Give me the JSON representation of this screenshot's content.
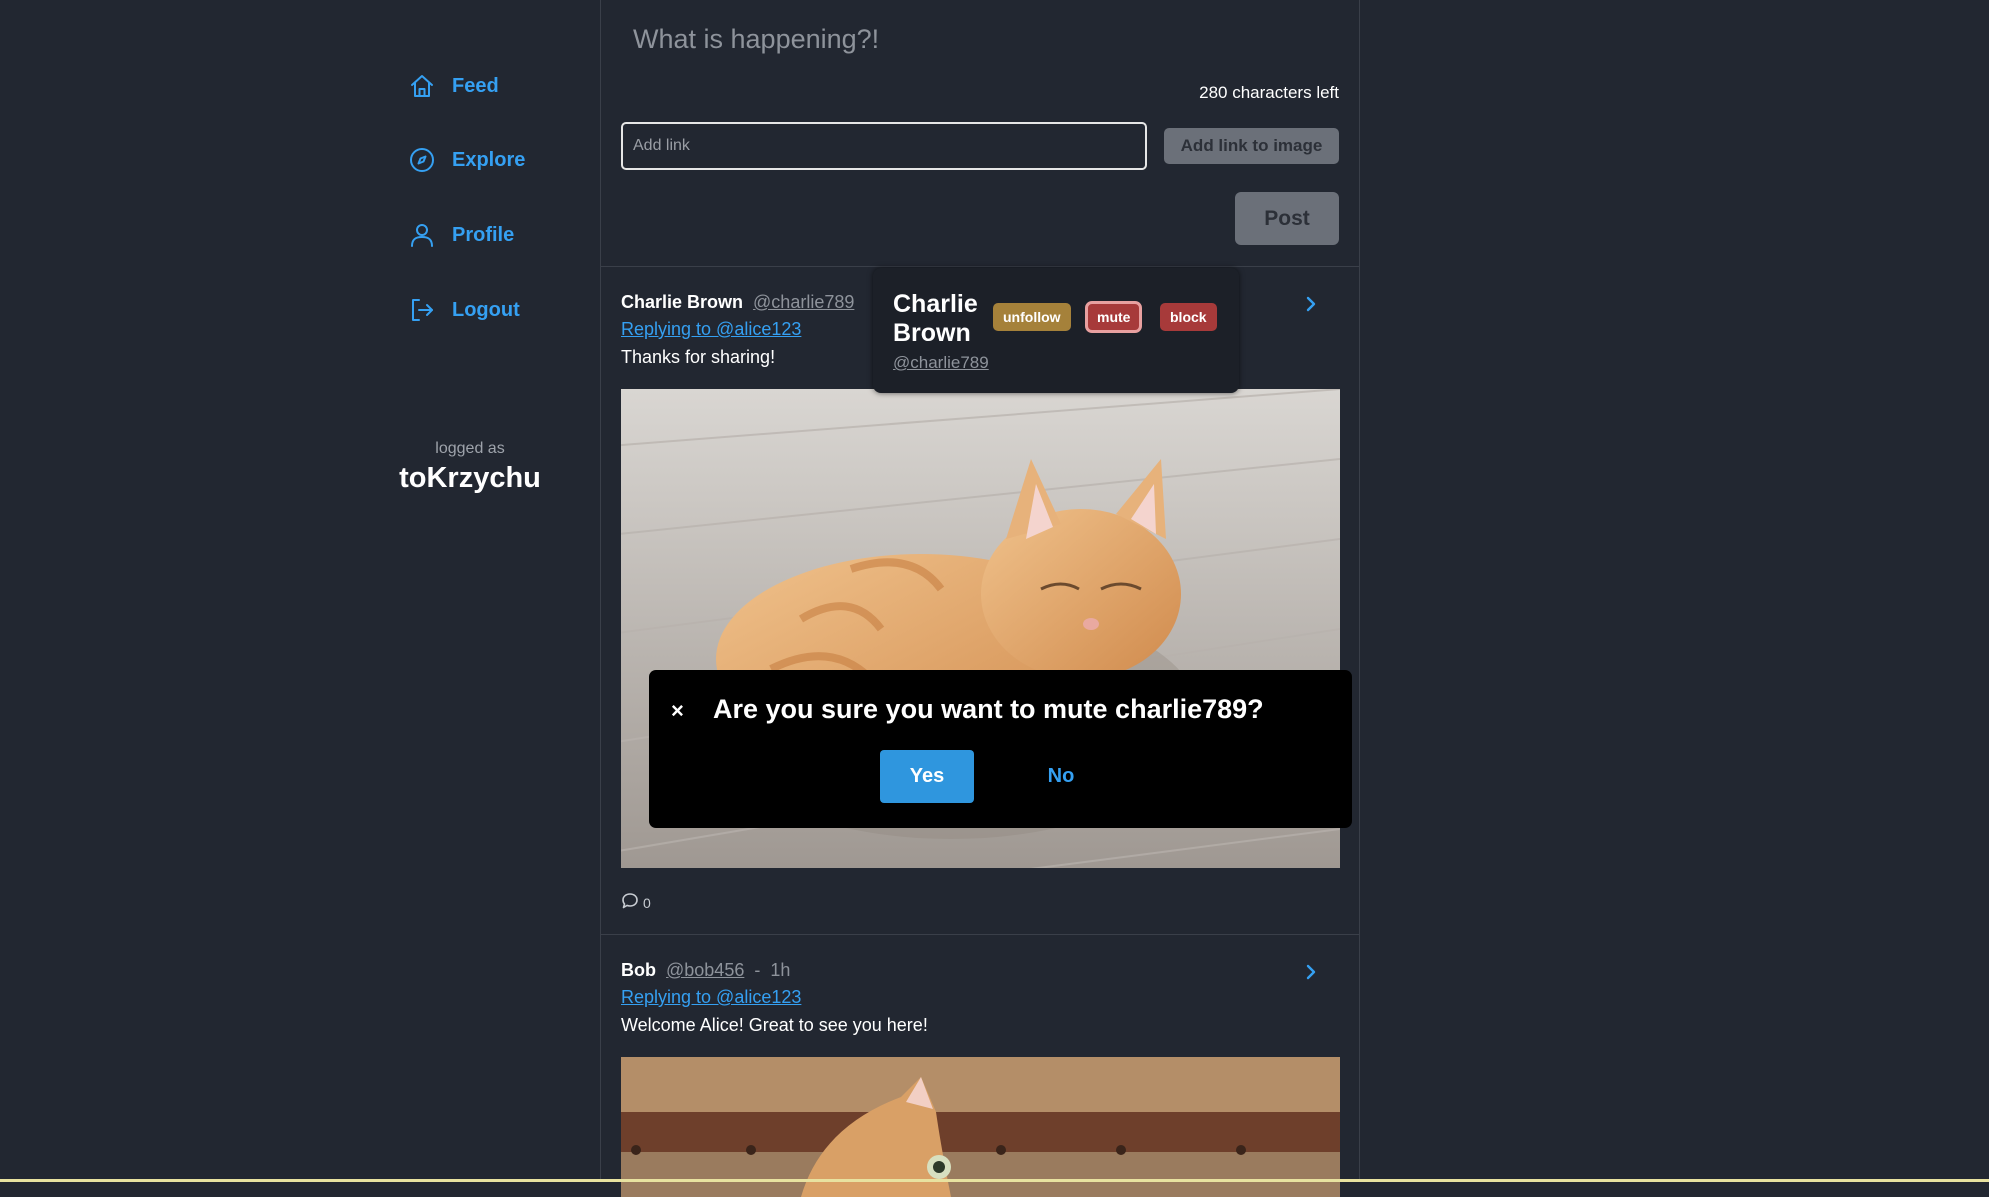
{
  "sidebar": {
    "items": [
      {
        "label": "Feed",
        "icon": "home-icon"
      },
      {
        "label": "Explore",
        "icon": "compass-icon"
      },
      {
        "label": "Profile",
        "icon": "user-icon"
      },
      {
        "label": "Logout",
        "icon": "logout-icon"
      }
    ],
    "logged_caption": "logged as",
    "username": "toKrzychu"
  },
  "composer": {
    "placeholder": "What is happening?!",
    "counter": "280 characters left",
    "link_placeholder": "Add link",
    "add_link_label": "Add link to image",
    "post_label": "Post"
  },
  "posts": [
    {
      "name": "Charlie Brown",
      "handle": "@charlie789",
      "time": "",
      "reply_to": "Replying to @alice123",
      "text": "Thanks for sharing!",
      "image": "orange-cat-lying-on-wooden-floor",
      "reply_count": "0"
    },
    {
      "name": "Bob",
      "handle": "@bob456",
      "separator": "-",
      "time": "1h",
      "reply_to": "Replying to @alice123",
      "text": "Welcome Alice! Great to see you here!",
      "image": "orange-kitten-on-wooden-chest"
    }
  ],
  "hover_card": {
    "name": "Charlie Brown",
    "handle": "@charlie789",
    "buttons": {
      "unfollow": "unfollow",
      "mute": "mute",
      "block": "block"
    }
  },
  "modal": {
    "close": "×",
    "message": "Are you sure you want to mute charlie789?",
    "yes": "Yes",
    "no": "No"
  },
  "colors": {
    "background": "#222731",
    "accent": "#35a0f2",
    "button_disabled": "#6b7079",
    "unfollow": "#a5813a",
    "danger": "#a73a3a",
    "modal_bg": "#000000"
  }
}
